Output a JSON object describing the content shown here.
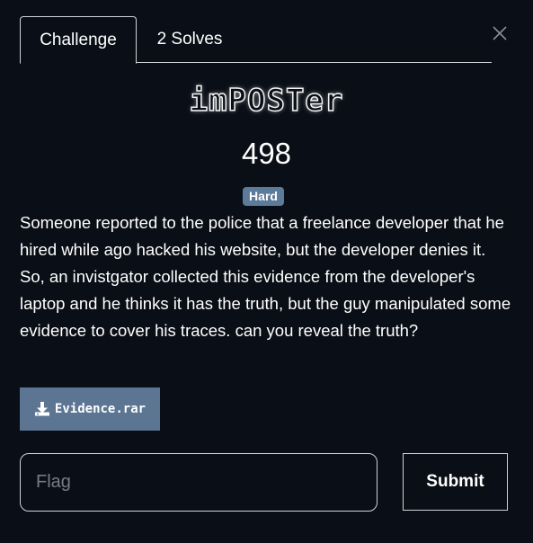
{
  "tabs": {
    "challenge": "Challenge",
    "solves": "2 Solves"
  },
  "challenge": {
    "name": "imPOSTer",
    "points": "498",
    "difficulty": "Hard",
    "description": "Someone reported to the police that a freelance developer that he hired while ago hacked his website, but the developer denies it. So, an invistgator collected this evidence from the developer's laptop and he thinks it has the truth, but the guy manipulated some evidence to cover his traces. can you reveal the truth?"
  },
  "files": [
    {
      "name": "Evidence.rar",
      "icon": "download-icon"
    }
  ],
  "flag_form": {
    "placeholder": "Flag",
    "value": "",
    "submit_label": "Submit"
  },
  "icons": {
    "close": "close-icon"
  },
  "colors": {
    "background": "#0a0e16",
    "badge": "#5c7a99",
    "file_button": "#5b7592",
    "border": "#cfd3d8"
  }
}
